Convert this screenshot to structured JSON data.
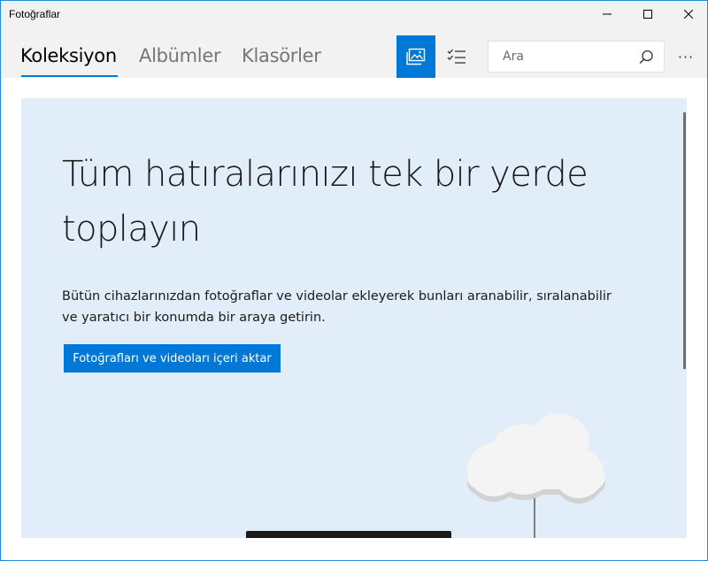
{
  "window": {
    "title": "Fotoğraflar",
    "accent_color": "#0078d7",
    "controls": {
      "minimize_icon": "minimize-icon",
      "maximize_icon": "maximize-icon",
      "close_icon": "close-icon"
    }
  },
  "header": {
    "tabs": [
      {
        "label": "Koleksiyon",
        "active": true
      },
      {
        "label": "Albümler",
        "active": false
      },
      {
        "label": "Klasörler",
        "active": false
      }
    ],
    "tools": {
      "collection_view_icon": "photo-collection-icon",
      "select_icon": "select-list-icon"
    },
    "search": {
      "placeholder": "Ara",
      "value": "",
      "icon": "search-icon"
    },
    "more_label": "···"
  },
  "main": {
    "headline": "Tüm hatıralarınızı tek bir yerde toplayın",
    "description": "Bütün cihazlarınızdan fotoğraflar ve videolar ekleyerek bunları aranabilir, sıralanabilir ve yaratıcı bir konumda bir araya getirin.",
    "import_button": "Fotoğrafları ve videoları içeri aktar",
    "panel_color": "#e1eef9",
    "illustration": "cloud-device-illustration"
  }
}
